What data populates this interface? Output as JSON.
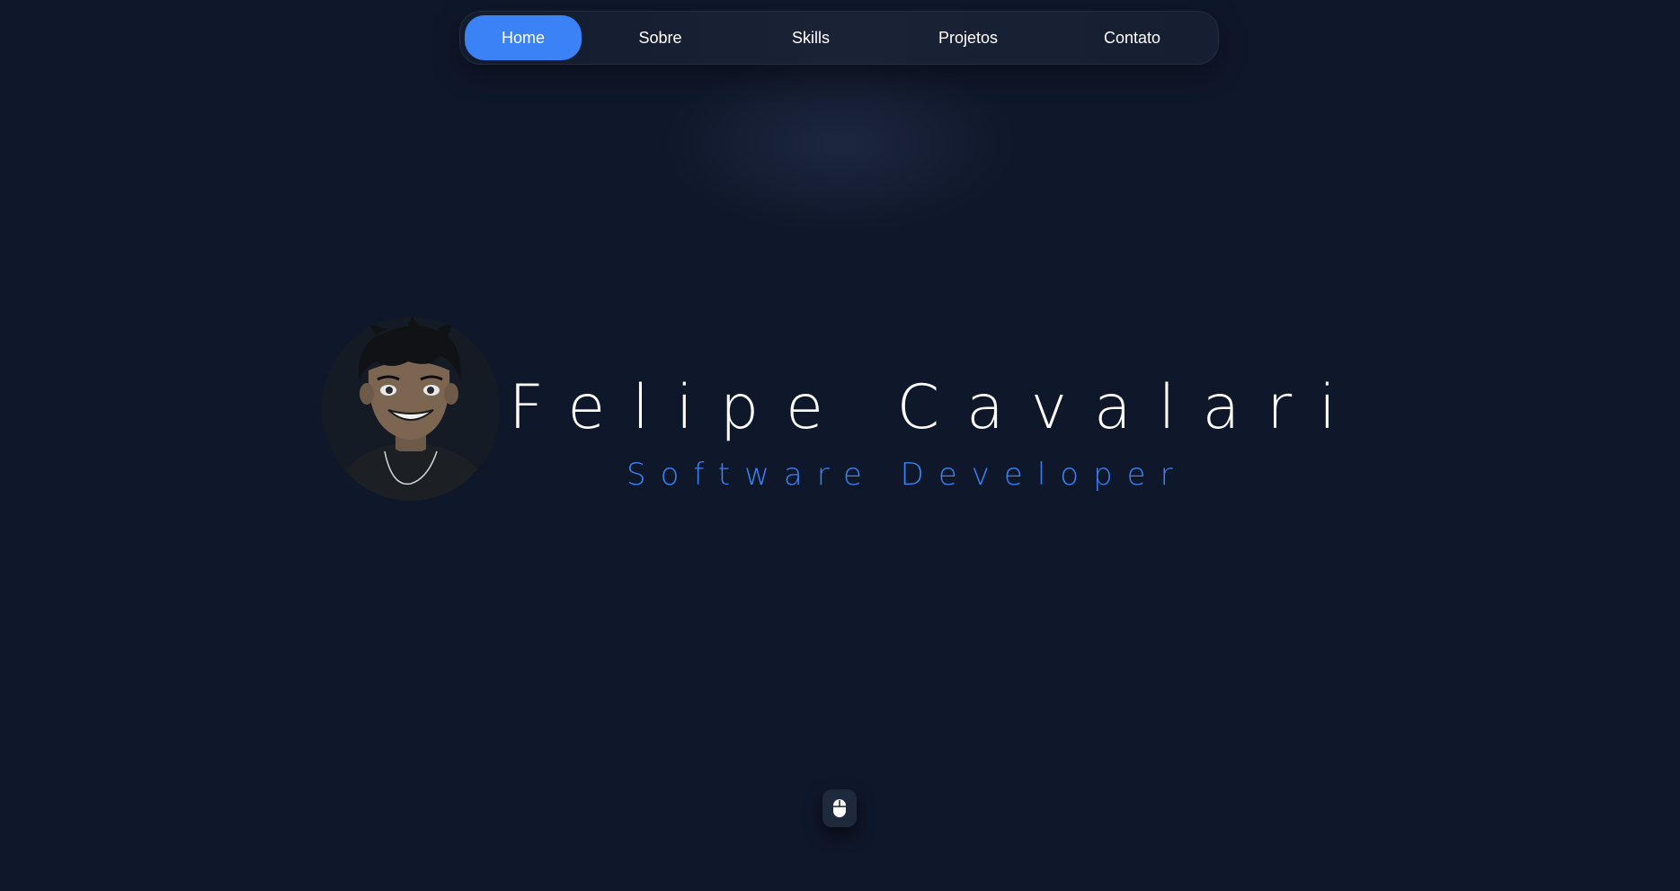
{
  "nav": {
    "items": [
      {
        "label": "Home",
        "active": true
      },
      {
        "label": "Sobre",
        "active": false
      },
      {
        "label": "Skills",
        "active": false
      },
      {
        "label": "Projetos",
        "active": false
      },
      {
        "label": "Contato",
        "active": false
      }
    ]
  },
  "hero": {
    "name": "Felipe Cavalari",
    "role": "Software Developer",
    "avatar_icon": "cartoon-portrait"
  },
  "scroll": {
    "icon": "mouse-icon"
  },
  "colors": {
    "background": "#0f172a",
    "accent": "#3b82f6",
    "text": "#ffffff"
  }
}
